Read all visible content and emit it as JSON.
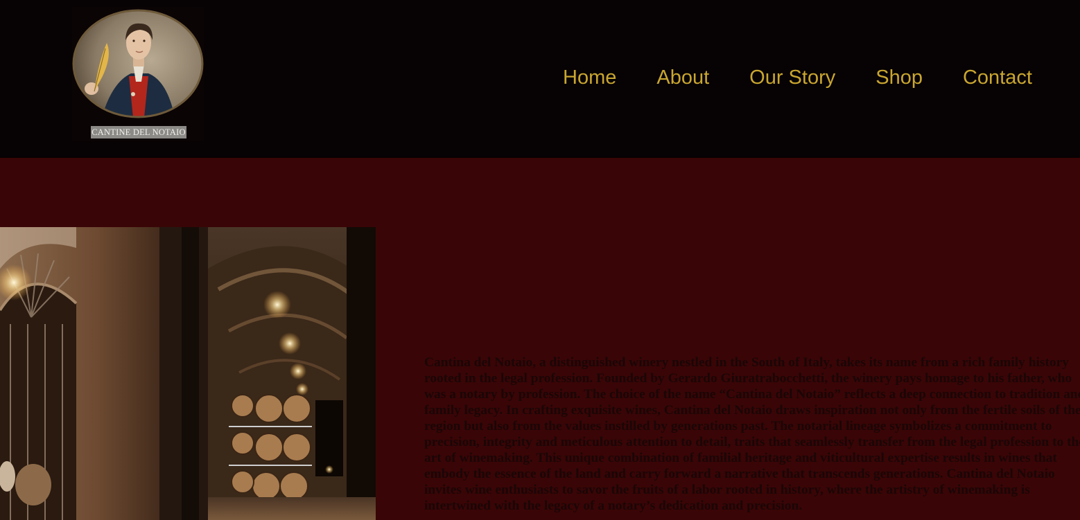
{
  "brand": {
    "logo_caption": "CANTINE DEL NOTAIO"
  },
  "nav": {
    "items": [
      {
        "label": "Home"
      },
      {
        "label": "About"
      },
      {
        "label": "Our Story"
      },
      {
        "label": "Shop"
      },
      {
        "label": "Contact"
      }
    ]
  },
  "about": {
    "body": "Cantina del Notaio, a distinguished winery nestled in the South of Italy, takes its name from a rich family history rooted in the legal profession. Founded by Gerardo Giuratrabocchetti, the winery pays homage to his father, who was a notary by profession. The choice of the name “Cantina del Notaio” reflects a deep connection to tradition and family legacy. In crafting exquisite wines, Cantina del Notaio draws inspiration not only from the fertile soils of the region but also from the values instilled by generations past. The notarial lineage symbolizes a commitment to precision, integrity and meticulous attention to detail, traits that seamlessly transfer from the legal profession to the art of winemaking. This unique combination of familial heritage and viticultural expertise results in wines that embody the essence of the land and carry forward a narrative that transcends generations. Cantina del Notaio invites wine enthusiasts to savor the fruits of a labor rooted in history, where the artistry of winemaking is intertwined with the legacy of a notary’s dedication and precision."
  },
  "colors": {
    "header_bg": "#070203",
    "page_bg": "#3a0506",
    "nav_link": "#c9a630",
    "body_text": "#1a0607"
  }
}
